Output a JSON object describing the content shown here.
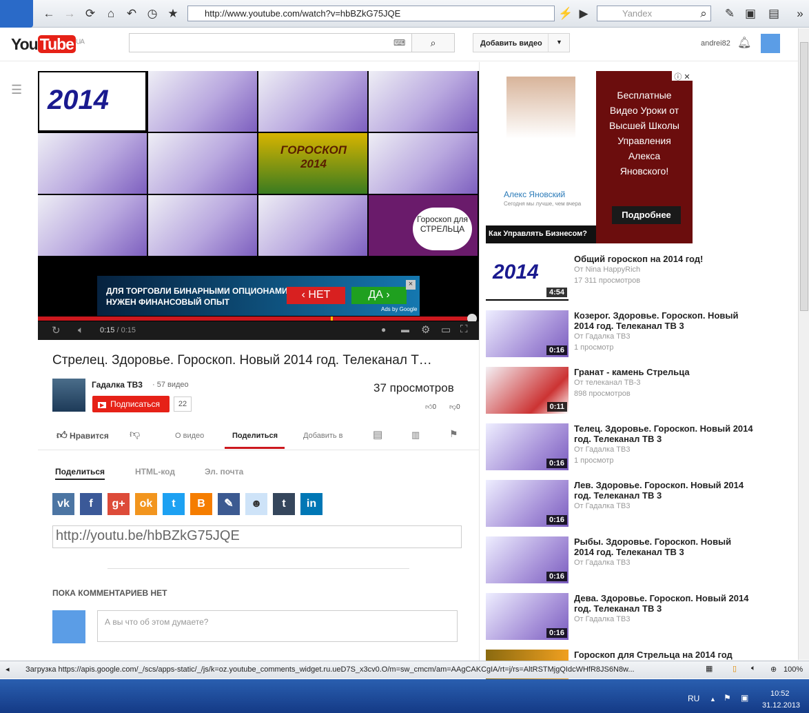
{
  "browser": {
    "url": "http://www.youtube.com/watch?v=hbBZkG75JQE",
    "search_placeholder": "Yandex",
    "status": "Загрузка https://apis.google.com/_/scs/apps-static/_/js/k=oz.youtube_comments_widget.ru.ueD7S_x3cv0.O/m=sw_cmcm/am=AAgCAKCgIA/rt=j/rs=AltRSTMjgQIdcWHfR8JS6N8w...",
    "zoom": "100%"
  },
  "header": {
    "logo": "You",
    "logo_tube": "Tube",
    "region": "UA",
    "upload": "Добавить видео",
    "user": "andrei82"
  },
  "player": {
    "tile_2014": "2014",
    "tile_horoscope": "ГОРОСКОП 2014",
    "tile_sagittarius": "Гороскоп для СТРЕЛЬЦА",
    "ad_line1": "ДЛЯ ТОРГОВЛИ БИНАРНЫМИ ОПЦИОНАМИ",
    "ad_line2": "НУЖЕН ФИНАНСОВЫЙ ОПЫТ",
    "ad_no": "‹ НЕТ",
    "ad_yes": "ДА ›",
    "ad_by": "Ads by Google",
    "time_current": "0:15",
    "time_total": "/ 0:15",
    "progress": 1.0
  },
  "video": {
    "title": "Стрелец. Здоровье. Гороскоп. Новый 2014 год. Телеканал Т…",
    "channel": "Гадалка ТВ3",
    "video_count": "· 57 видео",
    "subscribe": "Подписаться",
    "subscribers": "22",
    "views": "37 просмотров",
    "likes": "0",
    "dislikes": "0"
  },
  "actions": {
    "like": "Нравится",
    "about": "О видео",
    "share": "Поделиться",
    "add_to": "Добавить в"
  },
  "share": {
    "tabs": [
      "Поделиться",
      "HTML-код",
      "Эл. почта"
    ],
    "url": "http://youtu.be/hbBZkG75JQE"
  },
  "comments": {
    "heading": "ПОКА КОММЕНТАРИЕВ НЕТ",
    "placeholder": "А вы что об этом думаете?"
  },
  "rightad": {
    "text": "Бесплатные Видео Уроки от Высшей Школы Управления Алекса Яновского!",
    "person": "Алекс Яновский",
    "tagline": "Сегодня мы лучше, чем вчера",
    "button": "Подробнее",
    "bottom": "Как Управлять Бизнесом?"
  },
  "related": [
    {
      "title": "Общий гороскоп на 2014 год!",
      "channel": "От Nina HappyRich",
      "views": "17 311 просмотров",
      "duration": "4:54"
    },
    {
      "title": "Козерог. Здоровье. Гороскоп. Новый 2014 год. Телеканал ТВ 3",
      "channel": "От Гадалка ТВ3",
      "views": "1 просмотр",
      "duration": "0:16"
    },
    {
      "title": "Гранат - камень Стрельца",
      "channel": "От телеканал ТВ-3",
      "views": "898 просмотров",
      "duration": "0:11"
    },
    {
      "title": "Телец. Здоровье. Гороскоп. Новый 2014 год. Телеканал ТВ 3",
      "channel": "От Гадалка ТВ3",
      "views": "1 просмотр",
      "duration": "0:16"
    },
    {
      "title": "Лев. Здоровье. Гороскоп. Новый 2014 год. Телеканал ТВ 3",
      "channel": "От Гадалка ТВ3",
      "views": "",
      "duration": "0:16"
    },
    {
      "title": "Рыбы. Здоровье. Гороскоп. Новый 2014 год. Телеканал ТВ 3",
      "channel": "От Гадалка ТВ3",
      "views": "",
      "duration": "0:16"
    },
    {
      "title": "Дева. Здоровье. Гороскоп. Новый 2014 год. Телеканал ТВ 3",
      "channel": "От Гадалка ТВ3",
      "views": "",
      "duration": "0:16"
    },
    {
      "title": "Гороскоп для Стрельца на 2014 год",
      "channel": "",
      "views": "",
      "duration": ""
    }
  ],
  "taskbar": {
    "lang": "RU",
    "time": "10:52",
    "date": "31.12.2013"
  },
  "colors": {
    "accent": "#cc181e",
    "share_vk": "#4c75a3",
    "share_fb": "#3b5998",
    "share_gplus": "#dd4b39",
    "share_ok": "#f2951e",
    "share_tw": "#1da1f2",
    "share_blogger": "#f57d00",
    "share_lj": "#3c5a91",
    "share_reddit": "#cee3f8",
    "share_tumblr": "#35465c",
    "share_in": "#0077b5"
  }
}
